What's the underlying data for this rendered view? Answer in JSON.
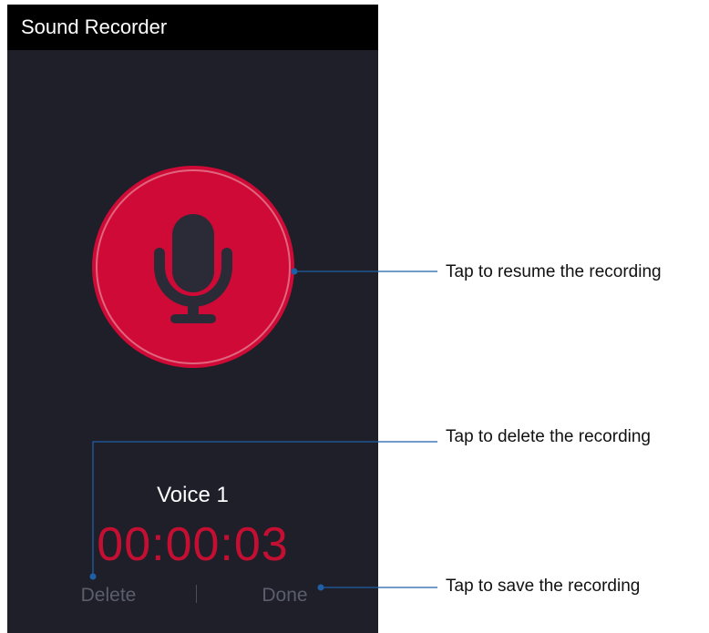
{
  "app": {
    "title": "Sound Recorder"
  },
  "recorder": {
    "record_button_state": "paused",
    "voice_name": "Voice 1",
    "elapsed_time": "00:00:03",
    "delete_label": "Delete",
    "done_label": "Done"
  },
  "callouts": {
    "resume": "Tap to resume the recording",
    "delete": "Tap to delete the recording",
    "save": "Tap to save the recording"
  },
  "colors": {
    "screen_background": "#1e1f29",
    "app_bar": "#000000",
    "record_button": "#cf0a36",
    "timer": "#c50f32",
    "callout_line": "#1f5fa6"
  },
  "icons": {
    "record_button": "microphone-icon"
  }
}
